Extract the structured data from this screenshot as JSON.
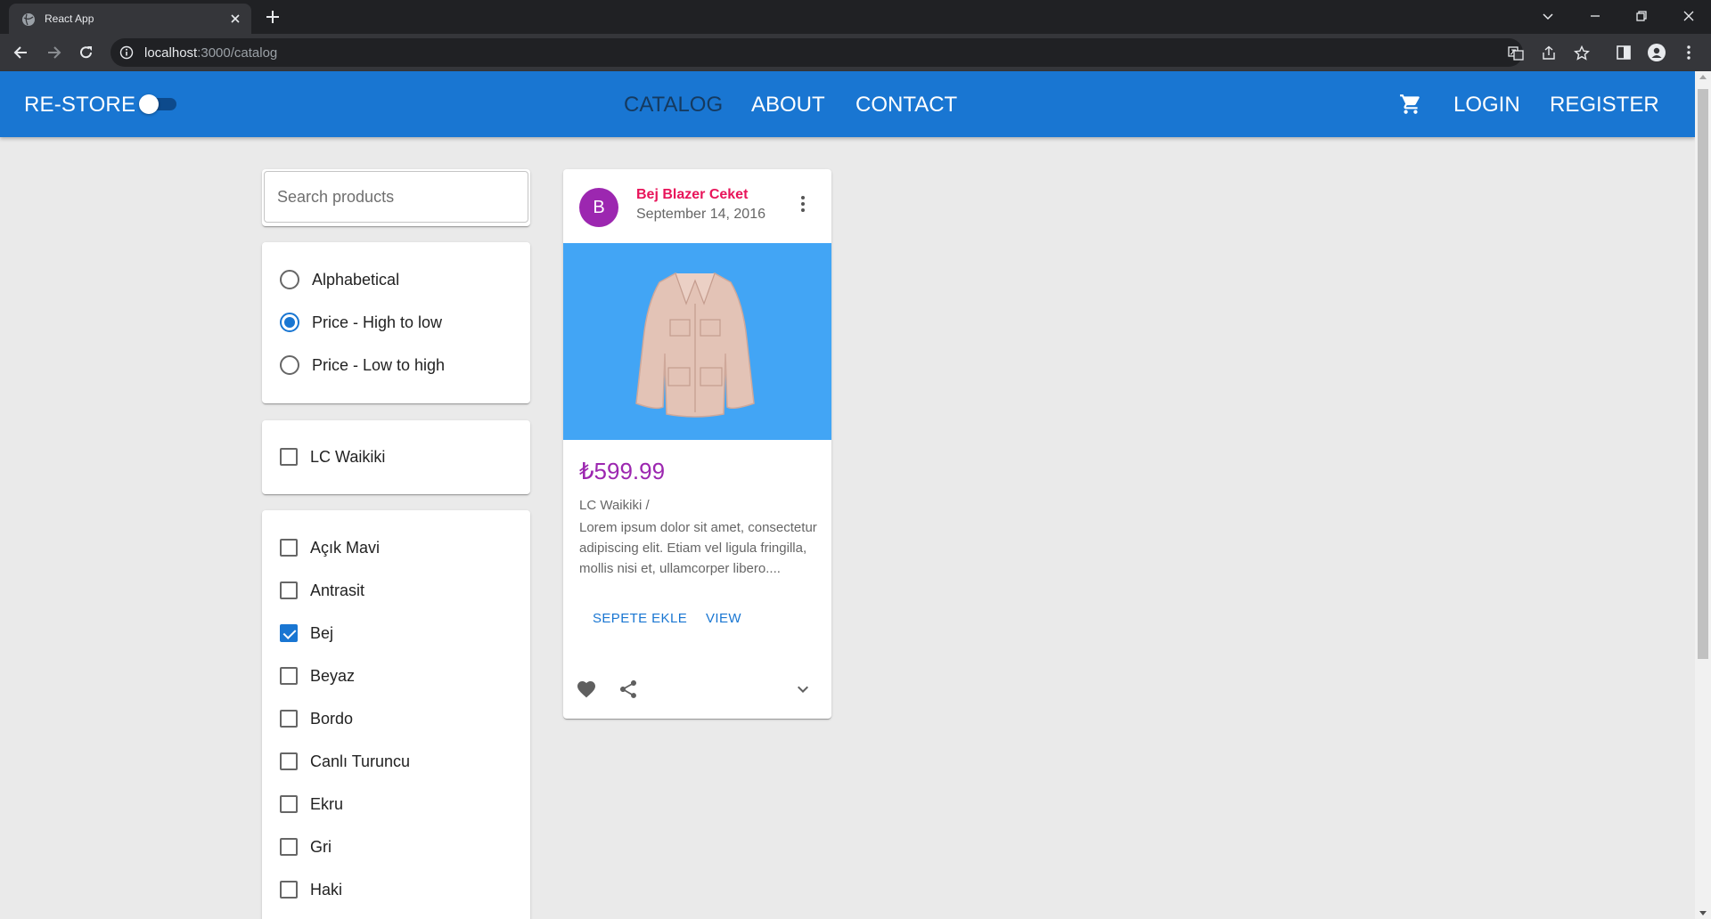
{
  "browser": {
    "tab_title": "React App",
    "url_host": "localhost",
    "url_path": ":3000/catalog"
  },
  "appbar": {
    "brand": "RE-STORE",
    "nav": [
      "CATALOG",
      "ABOUT",
      "CONTACT"
    ],
    "login": "LOGIN",
    "register": "REGISTER",
    "color": "#1976d2"
  },
  "search": {
    "placeholder": "Search products",
    "value": ""
  },
  "sort": {
    "options": [
      "Alphabetical",
      "Price - High to low",
      "Price - Low to high"
    ],
    "selected": "Price - High to low"
  },
  "brands": {
    "items": [
      {
        "label": "LC Waikiki",
        "checked": false
      }
    ]
  },
  "types": {
    "items": [
      {
        "label": "Açık Mavi",
        "checked": false
      },
      {
        "label": "Antrasit",
        "checked": false
      },
      {
        "label": "Bej",
        "checked": true
      },
      {
        "label": "Beyaz",
        "checked": false
      },
      {
        "label": "Bordo",
        "checked": false
      },
      {
        "label": "Canlı Turuncu",
        "checked": false
      },
      {
        "label": "Ekru",
        "checked": false
      },
      {
        "label": "Gri",
        "checked": false
      },
      {
        "label": "Haki",
        "checked": false
      }
    ]
  },
  "product": {
    "avatar_letter": "B",
    "title": "Bej Blazer Ceket",
    "date": "September 14, 2016",
    "price": "₺599.99",
    "brand_line": "LC Waikiki /",
    "description": "Lorem ipsum dolor sit amet, consectetur adipiscing elit. Etiam vel ligula fringilla, mollis nisi et, ullamcorper libero....",
    "add_to_cart": "SEPETE EKLE",
    "view": "VIEW",
    "media_color": "#42a5f5"
  }
}
